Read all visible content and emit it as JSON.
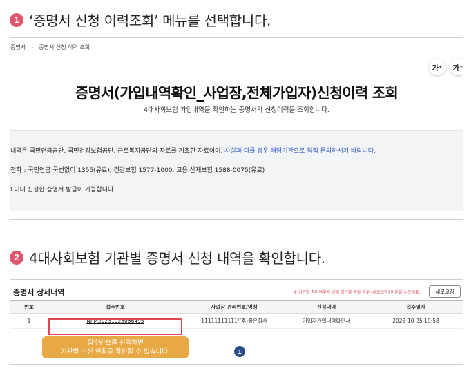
{
  "step1": {
    "number": "1",
    "text": "‘증명서 신청 이력조회’ 메뉴를 선택합니다."
  },
  "step2": {
    "number": "2",
    "text": "4대사회보험 기관별 증명서 신청 내역을 확인합니다."
  },
  "screen1": {
    "breadcrumb": {
      "current": "증명서",
      "separator": "›",
      "page": "증명서 신청 이력 조회"
    },
    "font_increase": "가⁺",
    "font_decrease": "가⁻",
    "title": "증명서(가입내역확인_사업장,전체가입자)신청이력 조회",
    "subtitle": "4대사회보험 가입내역을 확인하는 증명서의 신청이력을 조회합니다.",
    "info": [
      {
        "text": "내역은 국민연금공단, 국민건강보험공단, 근로복지공단의 자료를 기초한 자료이며, ",
        "highlight": "사실과 다를 경우 해당기관으로 직접 문의하시기 바랍니다."
      },
      {
        "text": "전화 : 국민연금 국번없이 1355(유료), 건강보험 1577-1000, 고용 산재보험 1588-0075(유료)"
      },
      {
        "text": "l 이내 신청한 증명서 발급이 가능합니다"
      }
    ]
  },
  "screen2": {
    "heading": "증명서 상세내역",
    "notice": "※ 기관별 처리여부의 상태 갱신을 원할 경우 [새로고침] 버튼을 누르세요.",
    "refresh_label": "새로고침",
    "columns": [
      "번호",
      "접수번호",
      "사업장 관리번호/명칭",
      "신청내역",
      "접수일자"
    ],
    "rows": [
      {
        "no": "1",
        "reg_no": "NPM20231025056495",
        "workplace": "11111111111/(주)좋은회사",
        "request": "가입자가입내역확인서",
        "date": "2023-10-25 19:58"
      }
    ],
    "tooltip": [
      "접수번호를 선택하면",
      "기관별 수신 현황을 확인할 수 있습니다."
    ],
    "page_badge": "1"
  },
  "colors": {
    "step_badge": "#e0566f",
    "highlight": "#2a56c6",
    "callout": "#e8a944",
    "outline": "#e0454f",
    "page_badge": "#2d4d8a"
  }
}
